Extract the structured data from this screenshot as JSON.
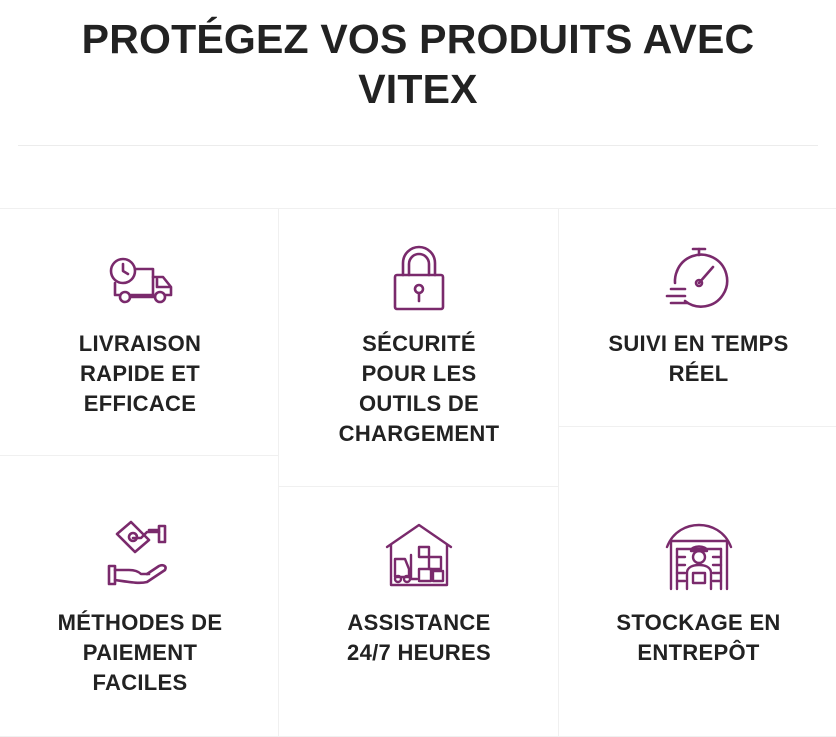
{
  "page": {
    "title_line1": "PROTÉGEZ VOS PRODUITS AVEC",
    "title_line2": "VITEX"
  },
  "features": [
    {
      "label_lines": [
        "LIVRAISON",
        "RAPIDE ET",
        "EFFICACE"
      ],
      "icon": "delivery-truck-clock-icon"
    },
    {
      "label_lines": [
        "SÉCURITÉ",
        "POUR LES",
        "OUTILS DE",
        "CHARGEMENT"
      ],
      "icon": "padlock-icon"
    },
    {
      "label_lines": [
        "SUIVI EN TEMPS",
        "RÉEL"
      ],
      "icon": "stopwatch-icon"
    },
    {
      "label_lines": [
        "MÉTHODES DE",
        "PAIEMENT",
        "FACILES"
      ],
      "icon": "hand-payment-icon"
    },
    {
      "label_lines": [
        "ASSISTANCE",
        "24/7 HEURES"
      ],
      "icon": "warehouse-forklift-icon"
    },
    {
      "label_lines": [
        "STOCKAGE EN",
        "ENTREPÔT"
      ],
      "icon": "warehouse-worker-icon"
    }
  ],
  "colors": {
    "icon_purple": "#7a2a6c",
    "text": "#222222",
    "divider": "#ececec"
  }
}
